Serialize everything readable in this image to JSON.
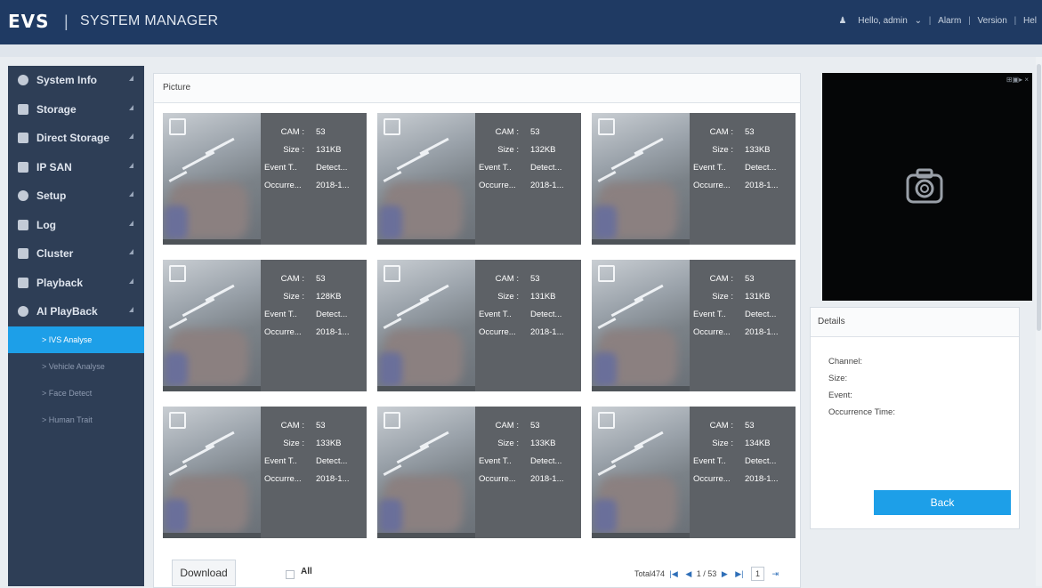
{
  "header": {
    "logo": "EVS",
    "title": "SYSTEM MANAGER",
    "user_greeting": "Hello, admin",
    "links": [
      "Alarm",
      "Version",
      "Hel"
    ]
  },
  "sidebar": {
    "items": [
      {
        "label": "System Info",
        "icon": "info-icon"
      },
      {
        "label": "Storage",
        "icon": "storage-icon"
      },
      {
        "label": "Direct Storage",
        "icon": "direct-storage-icon"
      },
      {
        "label": "IP SAN",
        "icon": "ip-san-icon"
      },
      {
        "label": "Setup",
        "icon": "gear-icon"
      },
      {
        "label": "Log",
        "icon": "log-icon"
      },
      {
        "label": "Cluster",
        "icon": "cluster-icon"
      },
      {
        "label": "Playback",
        "icon": "playback-icon"
      },
      {
        "label": "AI PlayBack",
        "icon": "ai-playback-icon"
      }
    ],
    "sub_items": [
      {
        "label": "> IVS Analyse",
        "active": true
      },
      {
        "label": "> Vehicle Analyse",
        "active": false
      },
      {
        "label": "> Face Detect",
        "active": false
      },
      {
        "label": "> Human Trait",
        "active": false
      }
    ]
  },
  "main": {
    "panel_title": "Picture",
    "labels": {
      "cam": "CAM :",
      "size": "Size :",
      "event": "Event T..",
      "time": "Occurre..."
    },
    "cards": [
      {
        "cam": "53",
        "size": "131KB",
        "event": "Detect...",
        "time": "2018-1..."
      },
      {
        "cam": "53",
        "size": "132KB",
        "event": "Detect...",
        "time": "2018-1..."
      },
      {
        "cam": "53",
        "size": "133KB",
        "event": "Detect...",
        "time": "2018-1..."
      },
      {
        "cam": "53",
        "size": "128KB",
        "event": "Detect...",
        "time": "2018-1..."
      },
      {
        "cam": "53",
        "size": "131KB",
        "event": "Detect...",
        "time": "2018-1..."
      },
      {
        "cam": "53",
        "size": "131KB",
        "event": "Detect...",
        "time": "2018-1..."
      },
      {
        "cam": "53",
        "size": "133KB",
        "event": "Detect...",
        "time": "2018-1..."
      },
      {
        "cam": "53",
        "size": "133KB",
        "event": "Detect...",
        "time": "2018-1..."
      },
      {
        "cam": "53",
        "size": "134KB",
        "event": "Detect...",
        "time": "2018-1..."
      }
    ],
    "download_label": "Download",
    "all_label": "All",
    "pager": {
      "total_label": "Total474",
      "page_info": "1 / 53",
      "page_input": "1"
    }
  },
  "preview": {
    "icon": "camera-icon",
    "tools": "⊞▣▸ ×"
  },
  "details": {
    "title": "Details",
    "fields": [
      "Channel:",
      "Size:",
      "Event:",
      "Occurrence Time:"
    ],
    "back_label": "Back"
  },
  "colors": {
    "header": "#1f3a63",
    "sidebar": "#2e3e56",
    "accent": "#1d9fe8",
    "card": "#5d6166"
  }
}
